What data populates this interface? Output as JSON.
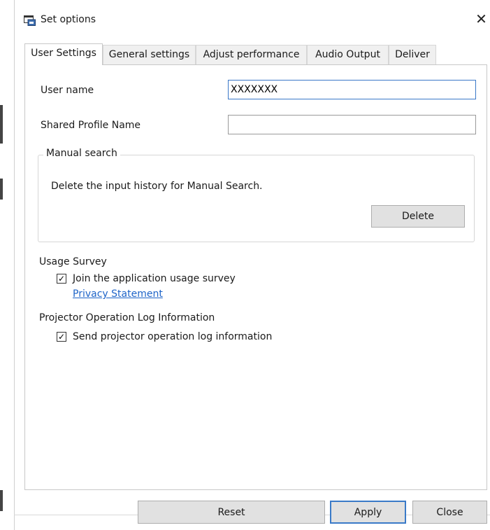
{
  "window": {
    "title": "Set options",
    "icon": "app-window-icon",
    "close_glyph": "✕"
  },
  "tabs": [
    {
      "label": "User Settings",
      "active": true
    },
    {
      "label": "General settings",
      "active": false
    },
    {
      "label": "Adjust performance",
      "active": false
    },
    {
      "label": "Audio Output",
      "active": false
    },
    {
      "label": "Deliver",
      "active": false
    }
  ],
  "user_settings": {
    "user_name_label": "User name",
    "user_name_value": "XXXXXXX",
    "shared_profile_label": "Shared Profile Name",
    "shared_profile_value": "",
    "manual_search": {
      "caption": "Manual search",
      "description": "Delete the input history for Manual Search.",
      "delete_label": "Delete"
    },
    "usage_survey": {
      "heading": "Usage Survey",
      "checkbox_label": "Join the application usage survey",
      "checked": true,
      "privacy_link": "Privacy Statement"
    },
    "projector_log": {
      "heading": "Projector Operation Log Information",
      "checkbox_label": "Send projector operation log information",
      "checked": true
    }
  },
  "footer": {
    "reset_label": "Reset",
    "apply_label": "Apply",
    "close_label": "Close"
  },
  "check_glyph": "✓",
  "colors": {
    "accent": "#3a7ac8",
    "link": "#1e64c8",
    "button_face": "#e1e1e1"
  }
}
